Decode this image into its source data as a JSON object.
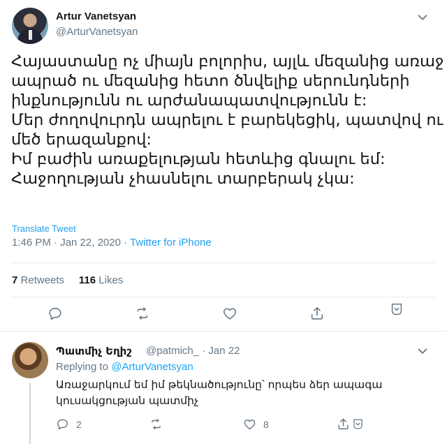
{
  "main_tweet": {
    "author_name": "Artur Vanetsyan",
    "author_handle": "@ArturVanetsyan",
    "lines": [
      "Հայաստանը ոչ միայն բոլորիս, այլև մեզանից առաջ",
      "ապրած ու մեզանից հետո ծնվելիք սերունդների",
      "ինքնությունն ու արժանապատվությունն է:",
      "Մեր ժողովուրդն ապրելու է բարեկեցիկ, պատվով ու",
      "մեծ երազանքով:",
      "Իմ բաժին առաքելության հետևից գնալու եմ:",
      "Հաջողության չհասնելու տարբերակ չկա:"
    ],
    "translate_label": "Translate Tweet",
    "timestamp": "1:46 PM · Jan 22, 2020 · ",
    "source": "Twitter for iPhone",
    "retweets_count": "7",
    "retweets_label": "Retweets",
    "likes_count": "116",
    "likes_label": "Likes"
  },
  "reply_tweet": {
    "author_name": "Պատմիչ Եղիշ",
    "author_handle": "@patmich_ · Jan 22",
    "replying_prefix": "Replying to ",
    "replying_to": "@ArturVanetsyan",
    "lines": [
      "Առաջարկում եմ իմ թեկնածությունը՝ որպես ձեր ապագա",
      "կուսակցության պատմիչ"
    ],
    "reply_count": "2",
    "like_count": "8"
  },
  "colors": {
    "accent": "#1da1f2",
    "muted": "#657786",
    "text": "#14171a",
    "border": "#e6ecf0"
  },
  "icons": [
    "chevron-down-icon",
    "reply-icon",
    "retweet-icon",
    "like-icon",
    "share-icon"
  ]
}
